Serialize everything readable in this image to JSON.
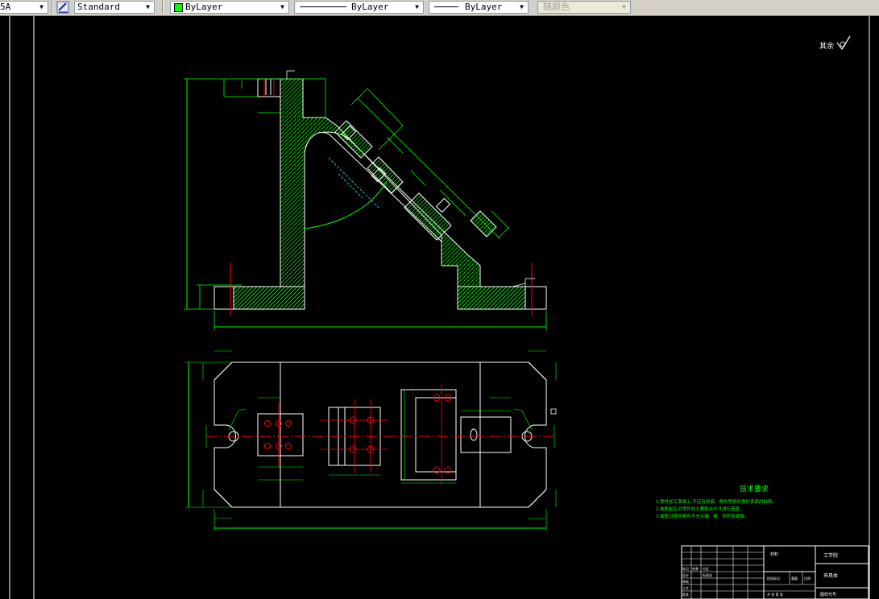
{
  "toolbar": {
    "text_style_value": "5A",
    "dim_style_value": "Standard",
    "layer_value": "ByLayer",
    "linetype_value": "ByLayer",
    "lineweight_value": "ByLayer",
    "plotstyle_value": "随颜色"
  },
  "drawing": {
    "roughness_label": "其余",
    "tech_title": "技术要求",
    "tech_notes": [
      "1.零件加工表面上,不应有划痕、擦伤等损伤零件表面的缺陷。",
      "2.装配前应对零件的主要配合尺寸进行复查。",
      "3.装配过程中零件不允许磕、碰、划伤和锈蚀。"
    ],
    "title_block": {
      "material": "材料",
      "company": "工学院",
      "part_name": "夹具体",
      "drawing_code": "图样代号",
      "c1": "标记",
      "c2": "处数",
      "c3": "分区",
      "c4": "设计",
      "c5": "标准化",
      "c6": "阶段标记",
      "c7": "重量",
      "c8": "比例",
      "c9": "审核",
      "c10": "工艺",
      "c11": "批准",
      "c12": "共 张 第 张"
    }
  },
  "colors": {
    "green": "#00ff00",
    "red": "#ff0000",
    "white": "#ffffff",
    "cyan": "#00ffff",
    "background": "#000000"
  }
}
